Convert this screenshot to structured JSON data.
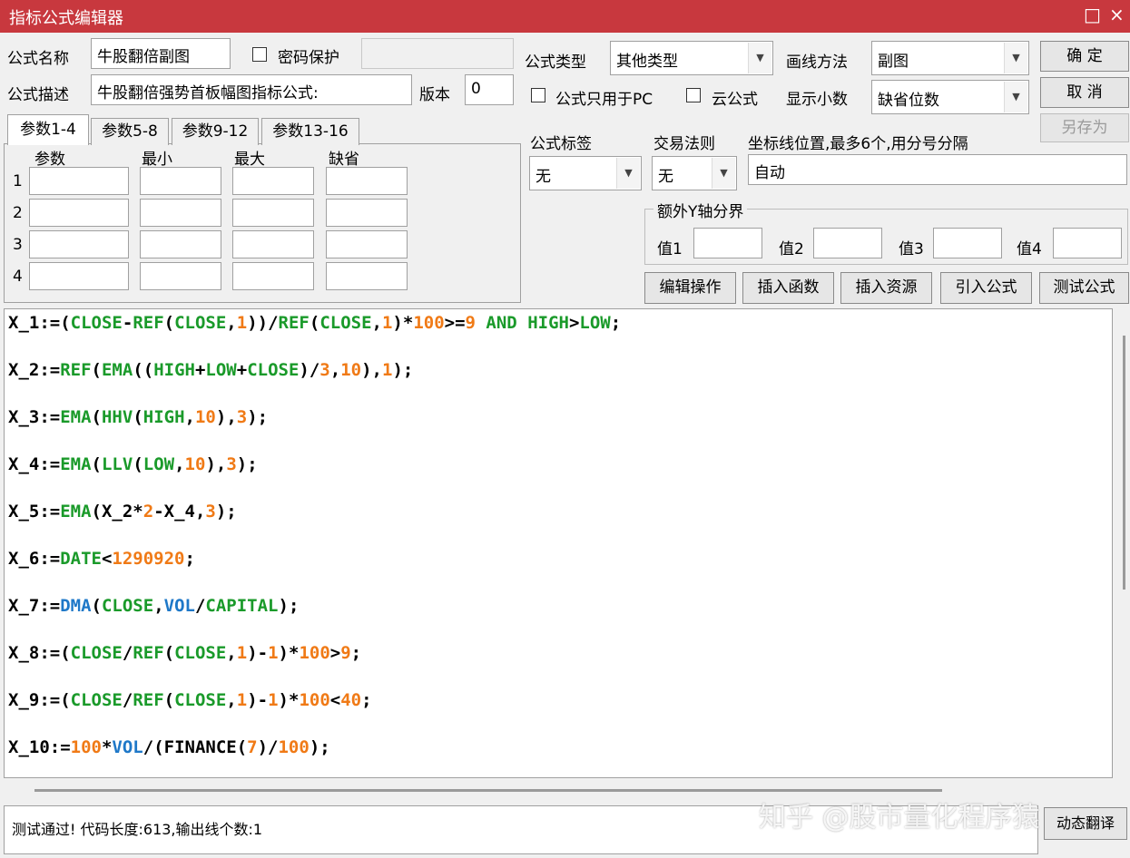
{
  "window": {
    "title": "指标公式编辑器",
    "maximize_glyph": "□",
    "close_glyph": "×"
  },
  "form": {
    "name_label": "公式名称",
    "name_value": "牛股翻倍副图",
    "password_label": "密码保护",
    "desc_label": "公式描述",
    "desc_value": "牛股翻倍强势首板幅图指标公式:",
    "version_label": "版本",
    "version_value": "0",
    "type_label": "公式类型",
    "type_value": "其他类型",
    "draw_label": "画线方法",
    "draw_value": "副图",
    "pc_only_label": "公式只用于PC",
    "cloud_label": "云公式",
    "decimals_label": "显示小数",
    "decimals_value": "缺省位数",
    "tag_label": "公式标签",
    "tag_value": "无",
    "trade_label": "交易法则",
    "trade_value": "无",
    "axis_label": "坐标线位置,最多6个,用分号分隔",
    "axis_value": "自动",
    "yaxis_group_label": "额外Y轴分界",
    "yaxis_values": [
      "值1",
      "值2",
      "值3",
      "值4"
    ]
  },
  "buttons": {
    "ok": "确  定",
    "cancel": "取  消",
    "save_as": "另存为",
    "edit_ops": "编辑操作",
    "insert_func": "插入函数",
    "insert_res": "插入资源",
    "import": "引入公式",
    "test": "测试公式",
    "translate": "动态翻译"
  },
  "params": {
    "tabs": [
      "参数1-4",
      "参数5-8",
      "参数9-12",
      "参数13-16"
    ],
    "headers": [
      "参数",
      "最小",
      "最大",
      "缺省"
    ],
    "rows": [
      "1",
      "2",
      "3",
      "4"
    ]
  },
  "code": [
    [
      [
        "X_1:=",
        "v"
      ],
      [
        "(",
        "p"
      ],
      [
        "CLOSE",
        "f"
      ],
      [
        "-",
        "p"
      ],
      [
        "REF",
        "f"
      ],
      [
        "(",
        "p"
      ],
      [
        "CLOSE",
        "f"
      ],
      [
        ",",
        "p"
      ],
      [
        "1",
        "n"
      ],
      [
        "))/",
        "p"
      ],
      [
        "REF",
        "f"
      ],
      [
        "(",
        "p"
      ],
      [
        "CLOSE",
        "f"
      ],
      [
        ",",
        "p"
      ],
      [
        "1",
        "n"
      ],
      [
        ")*",
        "p"
      ],
      [
        "100",
        "n"
      ],
      [
        ">=",
        "p"
      ],
      [
        "9",
        "n"
      ],
      [
        " AND ",
        "f"
      ],
      [
        "HIGH",
        "f"
      ],
      [
        ">",
        "p"
      ],
      [
        "LOW",
        "f"
      ],
      [
        ";",
        "p"
      ]
    ],
    [
      [
        "X_2:=",
        "v"
      ],
      [
        "REF",
        "f"
      ],
      [
        "(",
        "p"
      ],
      [
        "EMA",
        "f"
      ],
      [
        "((",
        "p"
      ],
      [
        "HIGH",
        "f"
      ],
      [
        "+",
        "p"
      ],
      [
        "LOW",
        "f"
      ],
      [
        "+",
        "p"
      ],
      [
        "CLOSE",
        "f"
      ],
      [
        ")/",
        "p"
      ],
      [
        "3",
        "n"
      ],
      [
        ",",
        "p"
      ],
      [
        "10",
        "n"
      ],
      [
        "),",
        "p"
      ],
      [
        "1",
        "n"
      ],
      [
        ");",
        "p"
      ]
    ],
    [
      [
        "X_3:=",
        "v"
      ],
      [
        "EMA",
        "f"
      ],
      [
        "(",
        "p"
      ],
      [
        "HHV",
        "f"
      ],
      [
        "(",
        "p"
      ],
      [
        "HIGH",
        "f"
      ],
      [
        ",",
        "p"
      ],
      [
        "10",
        "n"
      ],
      [
        "),",
        "p"
      ],
      [
        "3",
        "n"
      ],
      [
        ");",
        "p"
      ]
    ],
    [
      [
        "X_4:=",
        "v"
      ],
      [
        "EMA",
        "f"
      ],
      [
        "(",
        "p"
      ],
      [
        "LLV",
        "f"
      ],
      [
        "(",
        "p"
      ],
      [
        "LOW",
        "f"
      ],
      [
        ",",
        "p"
      ],
      [
        "10",
        "n"
      ],
      [
        "),",
        "p"
      ],
      [
        "3",
        "n"
      ],
      [
        ");",
        "p"
      ]
    ],
    [
      [
        "X_5:=",
        "v"
      ],
      [
        "EMA",
        "f"
      ],
      [
        "(X_2*",
        "p"
      ],
      [
        "2",
        "n"
      ],
      [
        "-X_4,",
        "p"
      ],
      [
        "3",
        "n"
      ],
      [
        ");",
        "p"
      ]
    ],
    [
      [
        "X_6:=",
        "v"
      ],
      [
        "DATE",
        "f"
      ],
      [
        "<",
        "p"
      ],
      [
        "1290920",
        "n"
      ],
      [
        ";",
        "p"
      ]
    ],
    [
      [
        "X_7:=",
        "v"
      ],
      [
        "DMA",
        "b"
      ],
      [
        "(",
        "p"
      ],
      [
        "CLOSE",
        "f"
      ],
      [
        ",",
        "p"
      ],
      [
        "VOL",
        "b"
      ],
      [
        "/",
        "p"
      ],
      [
        "CAPITAL",
        "f"
      ],
      [
        ");",
        "p"
      ]
    ],
    [
      [
        "X_8:=",
        "v"
      ],
      [
        "(",
        "p"
      ],
      [
        "CLOSE",
        "f"
      ],
      [
        "/",
        "p"
      ],
      [
        "REF",
        "f"
      ],
      [
        "(",
        "p"
      ],
      [
        "CLOSE",
        "f"
      ],
      [
        ",",
        "p"
      ],
      [
        "1",
        "n"
      ],
      [
        ")-",
        "p"
      ],
      [
        "1",
        "n"
      ],
      [
        ")*",
        "p"
      ],
      [
        "100",
        "n"
      ],
      [
        ">",
        "p"
      ],
      [
        "9",
        "n"
      ],
      [
        ";",
        "p"
      ]
    ],
    [
      [
        "X_9:=",
        "v"
      ],
      [
        "(",
        "p"
      ],
      [
        "CLOSE",
        "f"
      ],
      [
        "/",
        "p"
      ],
      [
        "REF",
        "f"
      ],
      [
        "(",
        "p"
      ],
      [
        "CLOSE",
        "f"
      ],
      [
        ",",
        "p"
      ],
      [
        "1",
        "n"
      ],
      [
        ")-",
        "p"
      ],
      [
        "1",
        "n"
      ],
      [
        ")*",
        "p"
      ],
      [
        "100",
        "n"
      ],
      [
        "<",
        "p"
      ],
      [
        "40",
        "n"
      ],
      [
        ";",
        "p"
      ]
    ],
    [
      [
        "X_10:=",
        "v"
      ],
      [
        "100",
        "n"
      ],
      [
        "*",
        "p"
      ],
      [
        "VOL",
        "b"
      ],
      [
        "/(FINANCE(",
        "p"
      ],
      [
        "7",
        "n"
      ],
      [
        ")/",
        "p"
      ],
      [
        "100",
        "n"
      ],
      [
        ");",
        "p"
      ]
    ]
  ],
  "status": "测试通过! 代码长度:613,输出线个数:1",
  "watermark": "知乎 @股市量化程序猿"
}
